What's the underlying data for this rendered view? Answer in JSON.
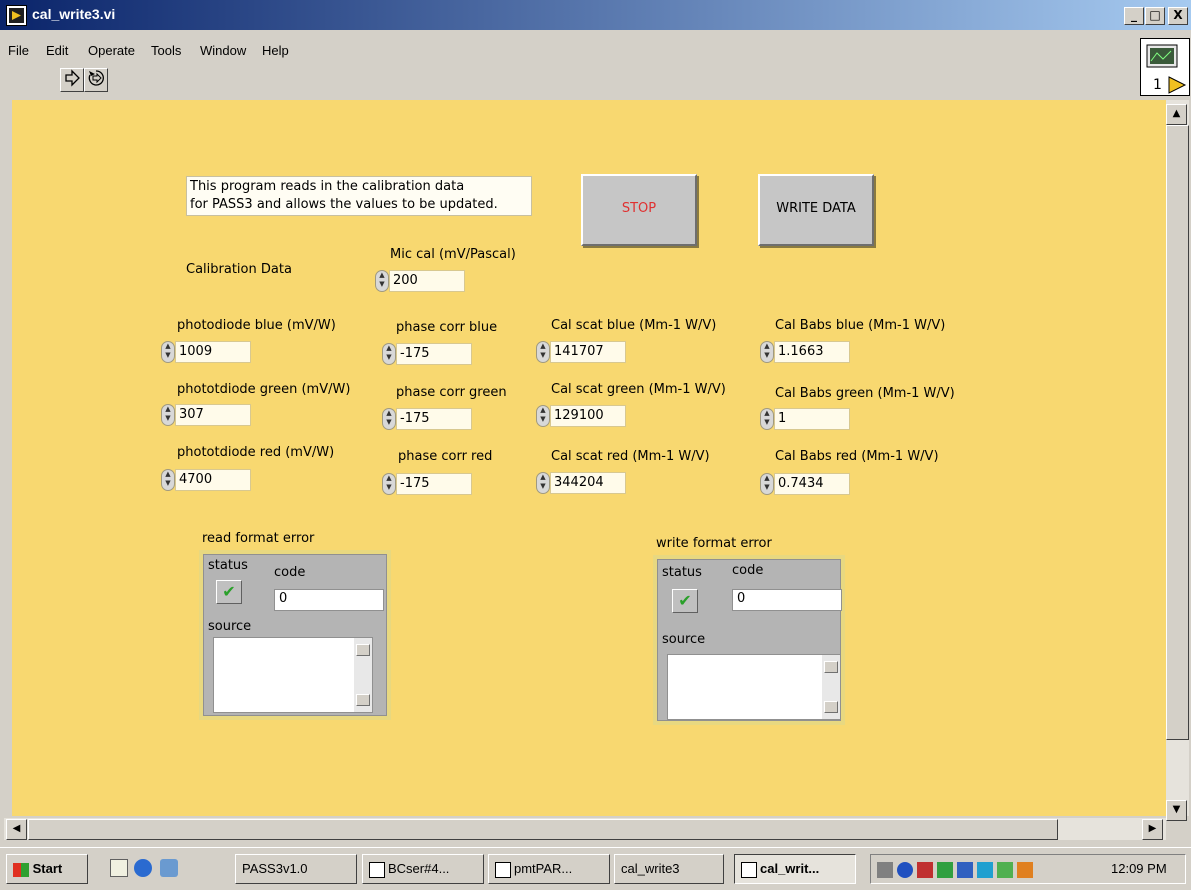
{
  "window": {
    "title": "cal_write3.vi"
  },
  "caption_buttons": {
    "minimize": "_",
    "maximize": "□",
    "close": "X"
  },
  "menu": [
    "File",
    "Edit",
    "Operate",
    "Tools",
    "Window",
    "Help"
  ],
  "toolbar": {
    "run_icon": "run-arrow-icon",
    "run_continuous_icon": "run-continuously-icon"
  },
  "panel": {
    "description_line1": "This program reads in the calibration data",
    "description_line2": "for PASS3 and allows the values to be updated.",
    "stop_label": "STOP",
    "write_label": "WRITE DATA",
    "calibration_label": "Calibration Data",
    "mic_cal": {
      "label": "Mic cal (mV/Pascal)",
      "value": "200"
    },
    "rows": [
      {
        "photodiode": {
          "label": "photodiode blue (mV/W)",
          "value": "1009"
        },
        "phase": {
          "label": "phase corr blue",
          "value": "-175"
        },
        "scat": {
          "label": "Cal scat blue (Mm-1 W/V)",
          "value": "141707"
        },
        "babs": {
          "label": "Cal Babs blue (Mm-1 W/V)",
          "value": "1.1663"
        }
      },
      {
        "photodiode": {
          "label": "phototdiode green (mV/W)",
          "value": "307"
        },
        "phase": {
          "label": "phase corr green",
          "value": "-175"
        },
        "scat": {
          "label": "Cal scat green (Mm-1 W/V)",
          "value": "129100"
        },
        "babs": {
          "label": "Cal Babs green (Mm-1 W/V)",
          "value": "1"
        }
      },
      {
        "photodiode": {
          "label": "phototdiode red (mV/W)",
          "value": "4700"
        },
        "phase": {
          "label": "phase corr red",
          "value": "-175"
        },
        "scat": {
          "label": "Cal scat red  (Mm-1 W/V)",
          "value": "344204"
        },
        "babs": {
          "label": "Cal Babs red  (Mm-1 W/V)",
          "value": "0.7434"
        }
      }
    ],
    "read_error": {
      "title": "read format error",
      "status": "status",
      "code_label": "code",
      "code_value": "0",
      "source": "source",
      "status_mark": "✔"
    },
    "write_error": {
      "title": "write format error",
      "status": "status",
      "code_label": "code",
      "code_value": "0",
      "source": "source",
      "status_mark": "✔"
    },
    "colors": {
      "panel": "#f8d870",
      "stop_text": "#e03030"
    }
  },
  "taskbar": {
    "start": "Start",
    "items": [
      "PASS3v1.0",
      "BCser#4...",
      "pmtPAR...",
      "cal_write3",
      "cal_writ..."
    ],
    "clock": "12:09 PM"
  }
}
